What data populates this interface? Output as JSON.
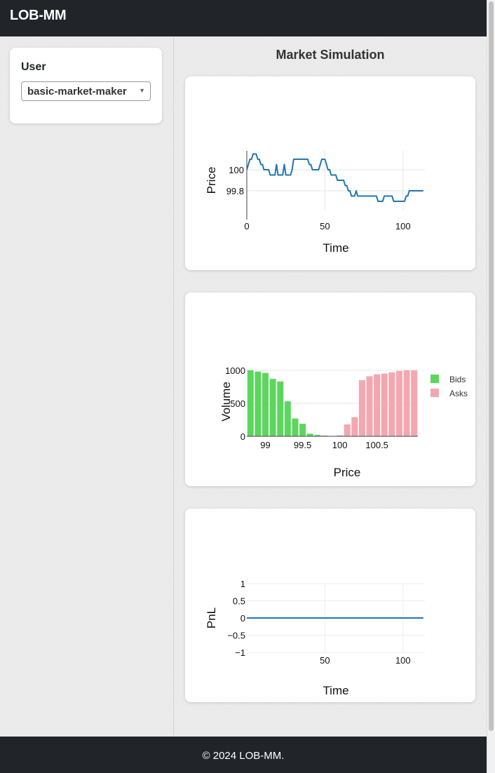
{
  "app": {
    "brand": "LOB-MM"
  },
  "sidebar": {
    "user_label": "User",
    "user_select_value": "basic-market-maker"
  },
  "main": {
    "title": "Market Simulation"
  },
  "footer": {
    "text": "© 2024 LOB-MM."
  },
  "colors": {
    "line": "#1f77b4",
    "bids": "#5cd65c",
    "asks": "#f4a7b0",
    "navbar": "#212529"
  },
  "icons": {
    "select_arrow": "chevron-down-icon"
  },
  "chart_data": [
    {
      "type": "line",
      "xlabel": "Time",
      "ylabel": "Price",
      "xlim": [
        0,
        114
      ],
      "ylim": [
        99.62,
        100.18
      ],
      "x_ticks": [
        0,
        50,
        100
      ],
      "y_ticks": [
        99.8,
        100
      ],
      "y_tick_labels": [
        "99.8",
        "100"
      ],
      "grid": true,
      "series": [
        {
          "x": [
            0,
            1,
            2,
            3,
            4,
            5,
            6,
            7,
            8,
            9,
            10,
            11,
            12,
            13,
            14,
            15,
            16,
            17,
            18,
            19,
            20,
            21,
            22,
            23,
            24,
            25,
            26,
            27,
            28,
            29,
            30,
            31,
            32,
            33,
            34,
            35,
            36,
            37,
            38,
            39,
            40,
            41,
            42,
            43,
            44,
            45,
            46,
            47,
            48,
            49,
            50,
            51,
            52,
            53,
            54,
            55,
            56,
            57,
            58,
            59,
            60,
            61,
            62,
            63,
            64,
            65,
            66,
            67,
            68,
            69,
            70,
            71,
            72,
            73,
            74,
            75,
            76,
            77,
            78,
            79,
            80,
            81,
            82,
            83,
            84,
            85,
            86,
            87,
            88,
            89,
            90,
            91,
            92,
            93,
            94,
            95,
            96,
            97,
            98,
            99,
            100,
            101,
            102,
            103,
            104,
            105,
            106,
            107,
            108,
            109,
            110,
            111,
            112,
            113
          ],
          "y": [
            100.0,
            100.05,
            100.1,
            100.1,
            100.15,
            100.15,
            100.15,
            100.1,
            100.1,
            100.05,
            100.05,
            100.0,
            100.0,
            100.0,
            100.0,
            99.95,
            99.95,
            99.95,
            99.95,
            100.05,
            99.95,
            99.95,
            99.95,
            99.95,
            100.05,
            99.95,
            99.95,
            99.95,
            99.95,
            100.0,
            100.1,
            100.1,
            100.1,
            100.1,
            100.1,
            100.1,
            100.1,
            100.1,
            100.1,
            100.1,
            100.05,
            100.05,
            100.0,
            100.0,
            100.0,
            100.0,
            100.0,
            100.05,
            100.1,
            100.1,
            100.1,
            100.05,
            100.0,
            100.0,
            99.95,
            99.95,
            99.95,
            99.95,
            99.9,
            99.9,
            99.9,
            99.9,
            99.9,
            99.85,
            99.85,
            99.8,
            99.8,
            99.75,
            99.75,
            99.75,
            99.8,
            99.75,
            99.75,
            99.75,
            99.75,
            99.75,
            99.75,
            99.75,
            99.75,
            99.75,
            99.75,
            99.75,
            99.75,
            99.75,
            99.7,
            99.7,
            99.7,
            99.7,
            99.75,
            99.75,
            99.75,
            99.75,
            99.75,
            99.75,
            99.7,
            99.7,
            99.7,
            99.7,
            99.7,
            99.7,
            99.7,
            99.7,
            99.75,
            99.75,
            99.8,
            99.8,
            99.8,
            99.8,
            99.8,
            99.8,
            99.8,
            99.8,
            99.8,
            99.8
          ]
        }
      ]
    },
    {
      "type": "bar",
      "xlabel": "Price",
      "ylabel": "Volume",
      "xlim": [
        98.75,
        101.05
      ],
      "ylim": [
        0,
        1020
      ],
      "x_ticks": [
        99,
        99.5,
        100,
        100.5
      ],
      "x_tick_labels": [
        "99",
        "99.5",
        "100",
        "100.5"
      ],
      "y_ticks": [
        0,
        500,
        1000
      ],
      "y_tick_labels": [
        "0",
        "500",
        "1000"
      ],
      "legend": "right",
      "series": [
        {
          "name": "Bids",
          "x": [
            98.8,
            98.9,
            99.0,
            99.1,
            99.2,
            99.3,
            99.4,
            99.5,
            99.6,
            99.7,
            99.8
          ],
          "values": [
            1000,
            980,
            960,
            870,
            830,
            530,
            270,
            190,
            40,
            20,
            10
          ]
        },
        {
          "name": "Asks",
          "x": [
            99.9,
            100.0,
            100.1,
            100.2,
            100.3,
            100.4,
            100.5,
            100.6,
            100.7,
            100.8,
            100.9,
            101.0
          ],
          "values": [
            5,
            15,
            180,
            290,
            850,
            910,
            940,
            950,
            970,
            990,
            1000,
            1000
          ]
        }
      ]
    },
    {
      "type": "line",
      "xlabel": "Time",
      "ylabel": "PnL",
      "xlim": [
        0,
        114
      ],
      "ylim": [
        -1,
        1
      ],
      "x_ticks": [
        50,
        100
      ],
      "y_ticks": [
        -1,
        -0.5,
        0,
        0.5,
        1
      ],
      "y_tick_labels": [
        "−1",
        "−0.5",
        "0",
        "0.5",
        "1"
      ],
      "grid": true,
      "series": [
        {
          "x": [
            0,
            113
          ],
          "y": [
            0,
            0
          ]
        }
      ]
    }
  ]
}
